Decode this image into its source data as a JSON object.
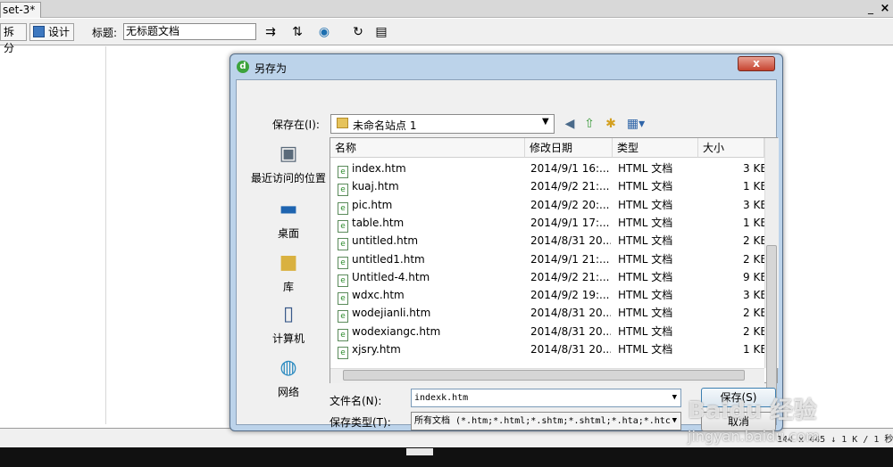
{
  "app": {
    "doc_tab": "set-3*",
    "win_min": "_",
    "win_close": "×",
    "toolbar": {
      "split_label": "拆分",
      "design_label": "设计",
      "title_label": "标题:",
      "title_value": "无标题文档"
    },
    "status": "144 x 445 ↓ 1 K / 1 秒"
  },
  "dialog": {
    "title": "另存为",
    "close": "x",
    "save_in_label": "保存在(I):",
    "save_in_value": "未命名站点 1",
    "places": [
      "最近访问的位置",
      "桌面",
      "库",
      "计算机",
      "网络"
    ],
    "columns": [
      "名称",
      "修改日期",
      "类型",
      "大小"
    ],
    "files": [
      {
        "name": "index.htm",
        "date": "2014/9/1 16:...",
        "type": "HTML 文档",
        "size": "3 KB"
      },
      {
        "name": "kuaj.htm",
        "date": "2014/9/2 21:...",
        "type": "HTML 文档",
        "size": "1 KB"
      },
      {
        "name": "pic.htm",
        "date": "2014/9/2 20:...",
        "type": "HTML 文档",
        "size": "3 KB"
      },
      {
        "name": "table.htm",
        "date": "2014/9/1 17:...",
        "type": "HTML 文档",
        "size": "1 KB"
      },
      {
        "name": "untitled.htm",
        "date": "2014/8/31 20...",
        "type": "HTML 文档",
        "size": "2 KB"
      },
      {
        "name": "untitled1.htm",
        "date": "2014/9/1 21:...",
        "type": "HTML 文档",
        "size": "2 KB"
      },
      {
        "name": "Untitled-4.htm",
        "date": "2014/9/2 21:...",
        "type": "HTML 文档",
        "size": "9 KB"
      },
      {
        "name": "wdxc.htm",
        "date": "2014/9/2 19:...",
        "type": "HTML 文档",
        "size": "3 KB"
      },
      {
        "name": "wodejianli.htm",
        "date": "2014/8/31 20...",
        "type": "HTML 文档",
        "size": "2 KB"
      },
      {
        "name": "wodexiangc.htm",
        "date": "2014/8/31 20...",
        "type": "HTML 文档",
        "size": "2 KB"
      },
      {
        "name": "xjsry.htm",
        "date": "2014/8/31 20...",
        "type": "HTML 文档",
        "size": "1 KB"
      }
    ],
    "filename_label": "文件名(N):",
    "filename_value": "indexk.htm",
    "filetype_label": "保存类型(T):",
    "filetype_value": "所有文档 (*.htm;*.html;*.shtm;*.shtml;*.hta;*.htc",
    "save_btn": "保存(S)",
    "cancel_btn": "取消"
  },
  "watermark": {
    "main": "Baidu 经验",
    "sub": "jingyan.baidu.com"
  },
  "colors": {
    "dialog_frame": "#bcd3ea",
    "close_btn": "#c6432f",
    "accent": "#3c7fb1"
  }
}
